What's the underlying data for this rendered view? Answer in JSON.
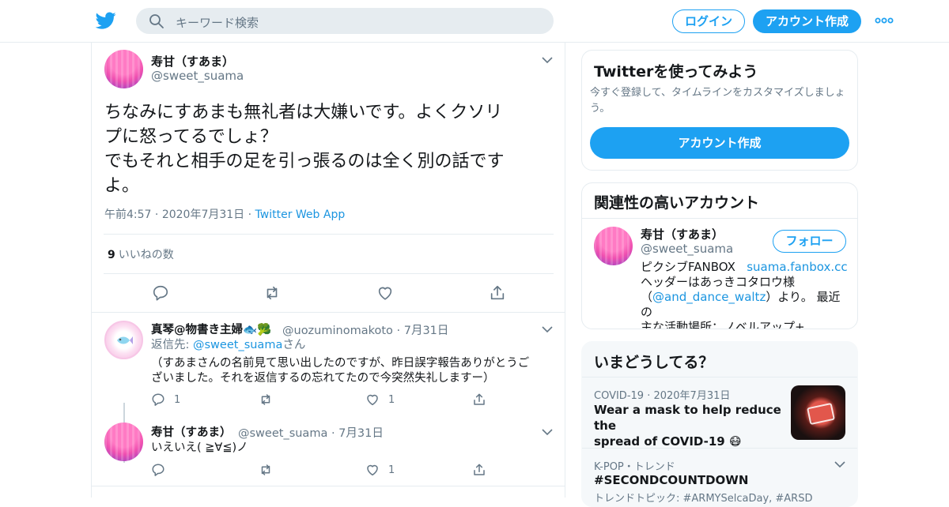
{
  "header": {
    "search_placeholder": "キーワード検索",
    "login_label": "ログイン",
    "signup_label": "アカウント作成"
  },
  "main_tweet": {
    "name": "寿甘（すあま）",
    "handle": "@sweet_suama",
    "text_lines": [
      "ちなみにすあまも無礼者は大嫌いです。よくクソリ",
      "プに怒ってるでしょ？",
      "でもそれと相手の足を引っ張るのは全く別の話です",
      "よ。"
    ],
    "time": "午前4:57",
    "date": "2020年7月31日",
    "via": "Twitter Web App",
    "like_count": "9",
    "like_label": "いいねの数"
  },
  "replies": [
    {
      "name": "真琴@物書き主婦🐟🥦",
      "handle": "@uozuminomakoto",
      "date": "7月31日",
      "reply_to_prefix": "返信先: ",
      "reply_to_handle": "@sweet_suama",
      "reply_to_suffix": "さん",
      "text_lines": [
        "（すあまさんの名前見て思い出したのですが、昨日誤字報告ありがとうご",
        "ざいました。それを返信するの忘れてたので今突然失礼しますー）"
      ],
      "reply_count": "1",
      "like_count": "1"
    },
    {
      "name": "寿甘（すあま）",
      "handle": "@sweet_suama",
      "date": "7月31日",
      "text": "いえいえ( ≧∀≦)ノ",
      "like_count": "1"
    }
  ],
  "sidebar": {
    "signup_card": {
      "title": "Twitterを使ってみよう",
      "subtitle": "今すぐ登録して、タイムラインをカスタマイズしましょう。",
      "button": "アカウント作成"
    },
    "related_card": {
      "title": "関連性の高いアカウント",
      "name": "寿甘（すあま）",
      "handle": "@sweet_suama",
      "follow": "フォロー",
      "bio_1": "ピクシブFANBOX",
      "bio_link": "suama.fanbox.cc",
      "bio_2": "ヘッダーはあっきコタロウ様",
      "bio_3_pre": "（",
      "bio_3_link": "@and_dance_waltz",
      "bio_3_post": "）より。 最近の",
      "bio_4": "主な活動場所：ノベルアップ+"
    },
    "trends_card": {
      "title": "いまどうしてる？",
      "t1_category": "COVID-19",
      "t1_date": "2020年7月31日",
      "t1_line1": "Wear a mask to help reduce the",
      "t1_line2": "spread of COVID-19 😷",
      "t2_category": "K-POP・トレンド",
      "t2_title": "#SECONDCOUNTDOWN",
      "t2_sub": "トレンドトピック: #ARMYSelcaDay, #ARSD"
    }
  },
  "colors": {
    "accent": "#1da1f2",
    "link": "#1b95e0",
    "muted": "#657786"
  }
}
